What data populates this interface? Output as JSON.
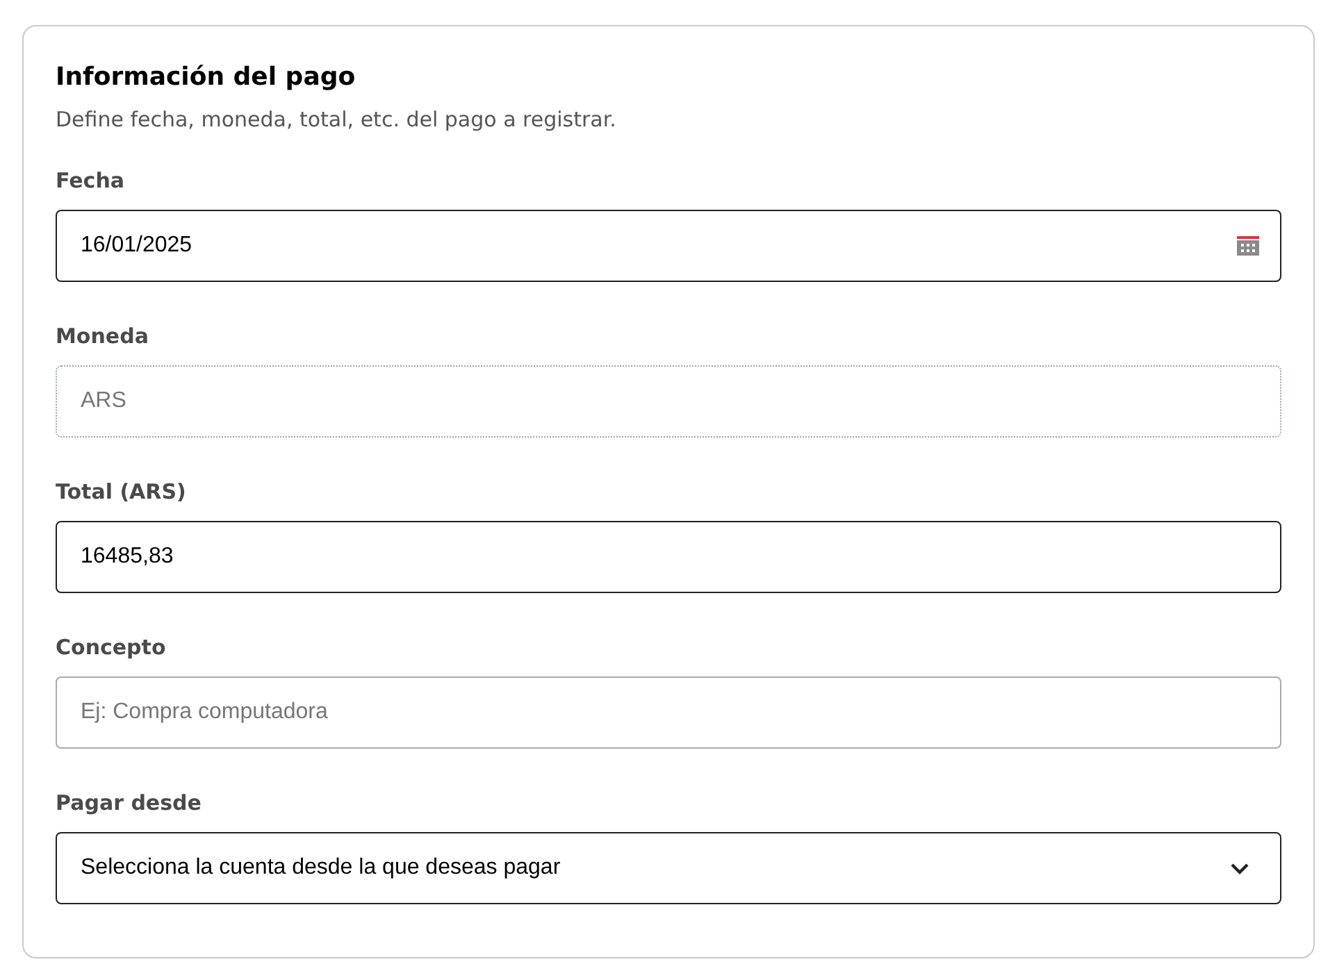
{
  "form": {
    "title": "Información del pago",
    "subtitle": "Define fecha, moneda, total, etc. del pago a registrar.",
    "fields": [
      {
        "kind": "date",
        "label": "Fecha",
        "value": "16/01/2025",
        "disabled": false
      },
      {
        "kind": "text",
        "label": "Moneda",
        "value": "ARS",
        "disabled": true
      },
      {
        "kind": "text",
        "label": "Total (ARS)",
        "value": "16485,83",
        "disabled": false
      },
      {
        "kind": "text",
        "label": "Concepto",
        "placeholder": "Ej: Compra computadora",
        "disabled": false
      },
      {
        "kind": "select",
        "label": "Pagar desde",
        "value": "Selecciona la cuenta desde la que deseas pagar",
        "disabled": false
      }
    ]
  }
}
